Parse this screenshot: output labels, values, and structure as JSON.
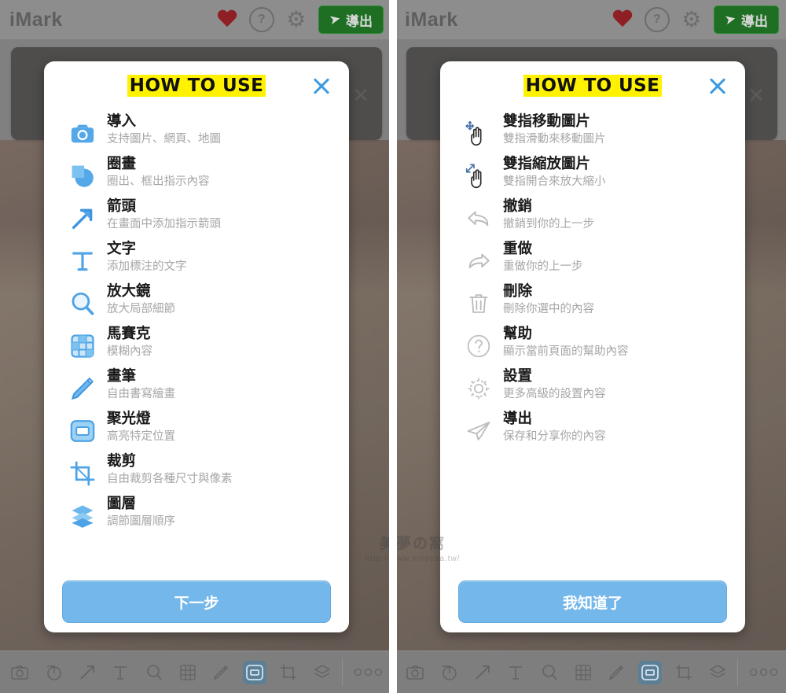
{
  "app": {
    "title": "iMark",
    "header_icons": [
      "heart-icon",
      "help-icon",
      "gear-icon"
    ],
    "help_glyph": "?",
    "export_label": "導出"
  },
  "watermark": {
    "line1": "美夢の窩",
    "line2": "http://www.xinoyaa.tw/"
  },
  "left_screen": {
    "modal": {
      "title": "HOW TO USE",
      "close_label": "×",
      "next_button": "下一步",
      "items": [
        {
          "icon": "camera-icon",
          "title": "導入",
          "desc": "支持圖片、網頁、地圖"
        },
        {
          "icon": "shape-icon",
          "title": "圈畫",
          "desc": "圈出、框出指示內容"
        },
        {
          "icon": "arrow-icon",
          "title": "箭頭",
          "desc": "在畫面中添加指示箭頭"
        },
        {
          "icon": "text-icon",
          "title": "文字",
          "desc": "添加標注的文字"
        },
        {
          "icon": "magnifier-icon",
          "title": "放大鏡",
          "desc": "放大局部細節"
        },
        {
          "icon": "mosaic-icon",
          "title": "馬賽克",
          "desc": "模糊內容"
        },
        {
          "icon": "pencil-icon",
          "title": "畫筆",
          "desc": "自由書寫繪畫"
        },
        {
          "icon": "spotlight-icon",
          "title": "聚光燈",
          "desc": "高亮特定位置"
        },
        {
          "icon": "crop-icon",
          "title": "裁剪",
          "desc": "自由裁剪各種尺寸與像素"
        },
        {
          "icon": "layers-icon",
          "title": "圖層",
          "desc": "調節圖層順序"
        }
      ]
    }
  },
  "right_screen": {
    "modal": {
      "title": "HOW TO USE",
      "close_label": "×",
      "back_label": "<",
      "done_button": "我知道了",
      "items": [
        {
          "icon": "two-finger-pan-icon",
          "title": "雙指移動圖片",
          "desc": "雙指滑動來移動圖片"
        },
        {
          "icon": "two-finger-zoom-icon",
          "title": "雙指縮放圖片",
          "desc": "雙指開合來放大縮小"
        },
        {
          "icon": "undo-icon",
          "title": "撤銷",
          "desc": "撤銷到你的上一步"
        },
        {
          "icon": "redo-icon",
          "title": "重做",
          "desc": "重做你的上一步"
        },
        {
          "icon": "trash-icon",
          "title": "刪除",
          "desc": "刪除你選中的內容"
        },
        {
          "icon": "help-circle-icon",
          "title": "幫助",
          "desc": "顯示當前頁面的幫助內容"
        },
        {
          "icon": "gear-icon",
          "title": "設置",
          "desc": "更多高級的設置內容"
        },
        {
          "icon": "send-icon",
          "title": "導出",
          "desc": "保存和分享你的內容"
        }
      ]
    }
  },
  "toolbar": {
    "tools": [
      "camera-icon",
      "shape-icon",
      "arrow-icon",
      "text-icon",
      "magnifier-icon",
      "mosaic-icon",
      "pencil-icon",
      "spotlight-icon",
      "crop-icon",
      "layers-icon"
    ],
    "active_tool": "spotlight-icon",
    "more_label": "more-icon"
  },
  "colors": {
    "accent_blue": "#74b7ea",
    "icon_blue": "#55a8e8",
    "highlight_yellow": "#fff200",
    "export_green": "#1e6f23",
    "heart_red": "#8d1f25"
  }
}
